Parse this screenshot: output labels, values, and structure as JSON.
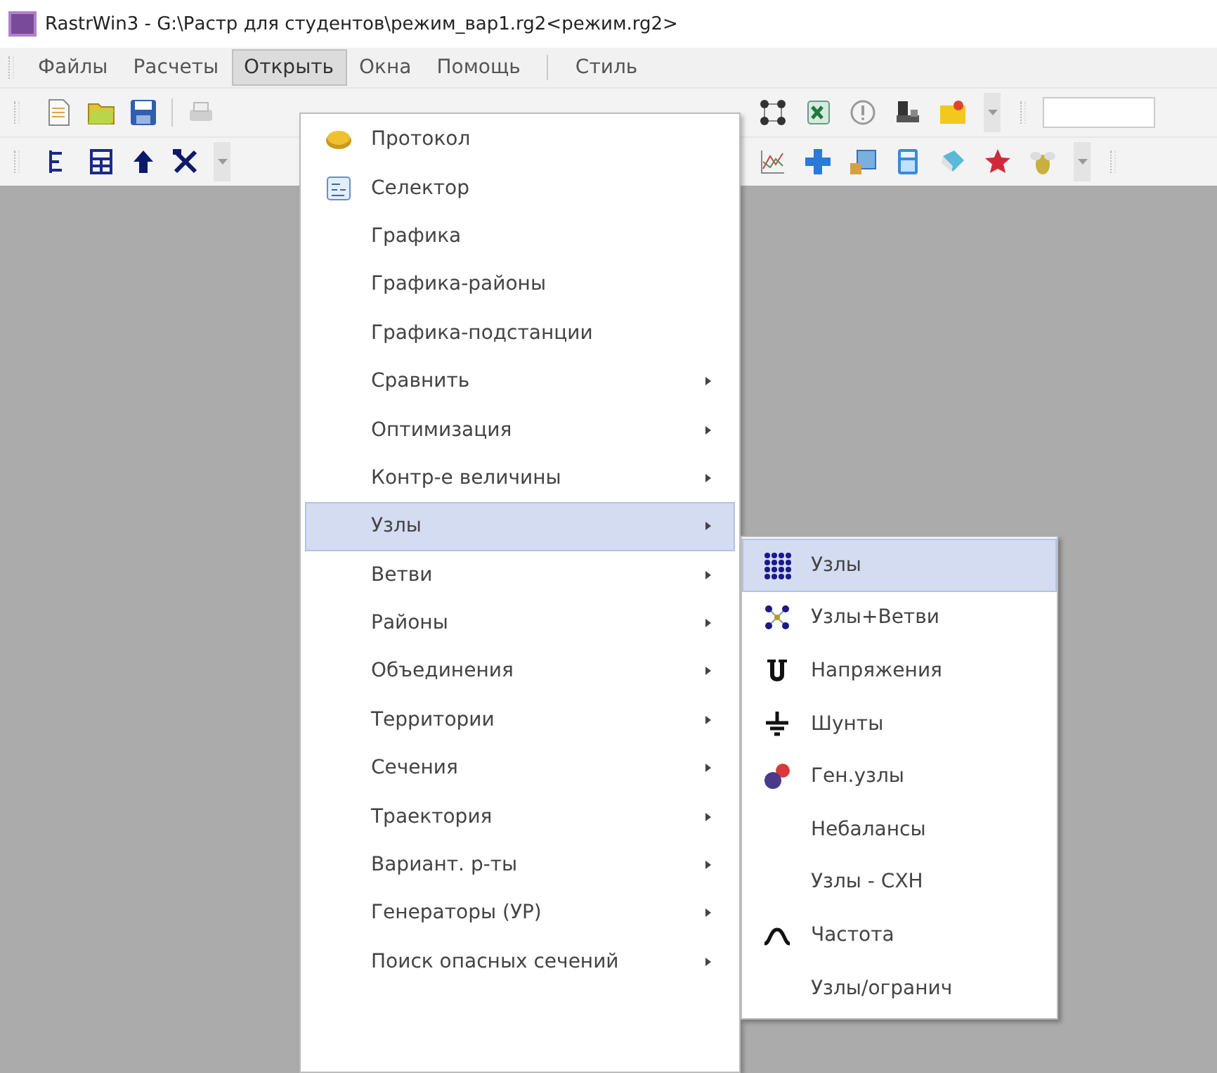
{
  "window": {
    "title": "RastrWin3 - G:\\Растр для студентов\\режим_вар1.rg2<режим.rg2>"
  },
  "menu_bar": [
    {
      "label": "Файлы",
      "selected": false
    },
    {
      "label": "Расчеты",
      "selected": false
    },
    {
      "label": "Открыть",
      "selected": true
    },
    {
      "label": "Окна",
      "selected": false
    },
    {
      "label": "Помощь",
      "selected": false
    },
    {
      "label": "Стиль",
      "selected": false
    }
  ],
  "open_menu": [
    {
      "label": "Протокол",
      "has_submenu": false,
      "selected": false
    },
    {
      "label": "Селектор",
      "has_submenu": false,
      "selected": false
    },
    {
      "label": "Графика",
      "has_submenu": false,
      "selected": false
    },
    {
      "label": "Графика-районы",
      "has_submenu": false,
      "selected": false
    },
    {
      "label": "Графика-подстанции",
      "has_submenu": false,
      "selected": false
    },
    {
      "label": "Сравнить",
      "has_submenu": true,
      "selected": false
    },
    {
      "label": "Оптимизация",
      "has_submenu": true,
      "selected": false
    },
    {
      "label": "Контр-е величины",
      "has_submenu": true,
      "selected": false
    },
    {
      "label": "Узлы",
      "has_submenu": true,
      "selected": true
    },
    {
      "label": "Ветви",
      "has_submenu": true,
      "selected": false
    },
    {
      "label": "Районы",
      "has_submenu": true,
      "selected": false
    },
    {
      "label": "Объединения",
      "has_submenu": true,
      "selected": false
    },
    {
      "label": "Территории",
      "has_submenu": true,
      "selected": false
    },
    {
      "label": "Сечения",
      "has_submenu": true,
      "selected": false
    },
    {
      "label": "Траектория",
      "has_submenu": true,
      "selected": false
    },
    {
      "label": "Вариант. р-ты",
      "has_submenu": true,
      "selected": false
    },
    {
      "label": "Генераторы (УР)",
      "has_submenu": true,
      "selected": false
    },
    {
      "label": "Поиск опасных сечений",
      "has_submenu": true,
      "selected": false
    }
  ],
  "submenu": [
    {
      "label": "Узлы",
      "selected": true
    },
    {
      "label": "Узлы+Ветви",
      "selected": false
    },
    {
      "label": "Напряжения",
      "selected": false
    },
    {
      "label": "Шунты",
      "selected": false
    },
    {
      "label": "Ген.узлы",
      "selected": false
    },
    {
      "label": "Небалансы",
      "selected": false
    },
    {
      "label": "Узлы - СХН",
      "selected": false
    },
    {
      "label": "Частота",
      "selected": false
    },
    {
      "label": "Узлы/огранич",
      "selected": false
    }
  ]
}
